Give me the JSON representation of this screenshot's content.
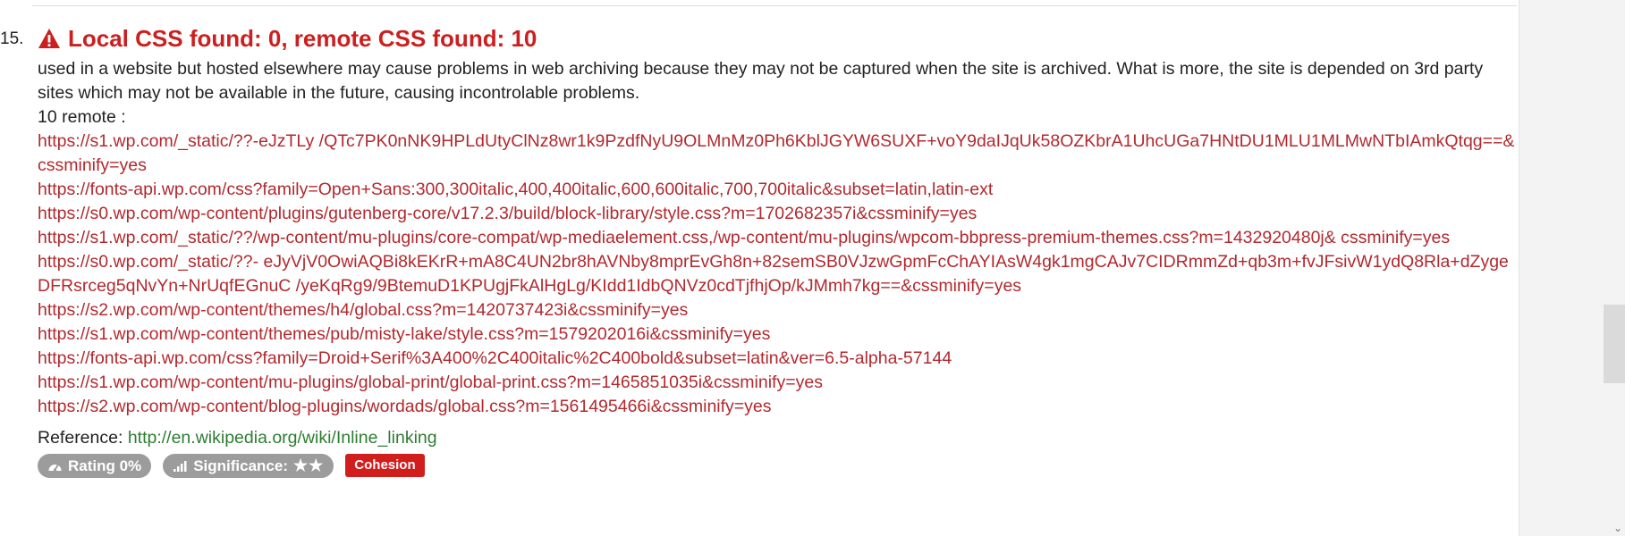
{
  "item": {
    "number": "15.",
    "title": "Local CSS found: 0, remote CSS found: 10",
    "icon": "warning-icon",
    "description": "used in a website but hosted elsewhere may cause problems in web archiving because they may not be captured when the site is archived. What is more, the site is depended on 3rd party sites which may not be available in the future, causing incontrolable problems.",
    "remote_count": "10 remote :",
    "urls": [
      "https://s1.wp.com/_static/??-eJzTLy /QTc7PK0nNK9HPLdUtyClNz8wr1k9PzdfNyU9OLMnMz0Ph6KblJGYW6SUXF+voY9daIJqUk58OZKbrA1UhcUGa7HNtDU1MLU1MLMwNTbIAmkQtqg==&cssminify=yes",
      "https://fonts-api.wp.com/css?family=Open+Sans:300,300italic,400,400italic,600,600italic,700,700italic&subset=latin,latin-ext",
      "https://s0.wp.com/wp-content/plugins/gutenberg-core/v17.2.3/build/block-library/style.css?m=1702682357i&cssminify=yes",
      "https://s1.wp.com/_static/??/wp-content/mu-plugins/core-compat/wp-mediaelement.css,/wp-content/mu-plugins/wpcom-bbpress-premium-themes.css?m=1432920480j& cssminify=yes",
      "https://s0.wp.com/_static/??- eJyVjV0OwiAQBi8kEKrR+mA8C4UN2br8hAVNby8mprEvGh8n+82semSB0VJzwGpmFcChAYIAsW4gk1mgCAJv7CIDRmmZd+qb3m+fvJFsivW1ydQ8Rla+dZygeDFRsrceg5qNvYn+NrUqfEGnuC /yeKqRg9/9BtemuD1KPUgjFkAlHgLg/KIdd1IdbQNVz0cdTjfhjOp/kJMmh7kg==&cssminify=yes",
      "https://s2.wp.com/wp-content/themes/h4/global.css?m=1420737423i&cssminify=yes",
      "https://s1.wp.com/wp-content/themes/pub/misty-lake/style.css?m=1579202016i&cssminify=yes",
      "https://fonts-api.wp.com/css?family=Droid+Serif%3A400%2C400italic%2C400bold&subset=latin&ver=6.5-alpha-57144",
      "https://s1.wp.com/wp-content/mu-plugins/global-print/global-print.css?m=1465851035i&cssminify=yes",
      "https://s2.wp.com/wp-content/blog-plugins/wordads/global.css?m=1561495466i&cssminify=yes"
    ],
    "reference_label": "Reference:",
    "reference_link": "http://en.wikipedia.org/wiki/Inline_linking",
    "badges": {
      "rating": "Rating 0%",
      "significance": "Significance:",
      "significance_stars": "★★",
      "category": "Cohesion"
    }
  },
  "colors": {
    "title": "#cc1f1f",
    "link": "#b2292e",
    "reference": "#2e7d32",
    "badge_gray": "#9c9c9c",
    "badge_red": "#d21d1d"
  }
}
